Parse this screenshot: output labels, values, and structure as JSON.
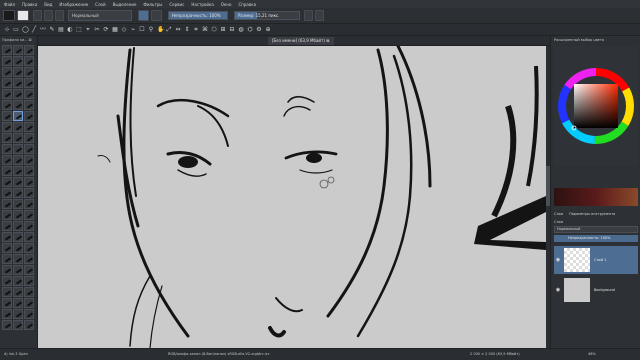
{
  "menu": [
    "Файл",
    "Правка",
    "Вид",
    "Изображение",
    "Слой",
    "Выделение",
    "Фильтры",
    "Сервис",
    "Настройка",
    "Окно",
    "Справка"
  ],
  "topbar": {
    "blend_mode": "Нормальный",
    "opacity_label": "Непрозрачность: 100%",
    "opacity_fraction": 1.0,
    "size_label": "Размер: 15,21 пикс.",
    "size_fraction": 0.35
  },
  "left_panel": {
    "title": "Профили ки... ⊠"
  },
  "canvas": {
    "tab_title": "[Без имени] (63,9 Мбайт) ⊠"
  },
  "right_panel": {
    "color_selector_title": "Расширенный выбор цвета",
    "tab_tools": "Слои",
    "tab_options": "Параметры инструмента",
    "layers_title": "Слои",
    "blend_mode": "Нормальный",
    "opacity_label": "Непрозрачность: 100%",
    "layers": [
      {
        "name": "Слой 1",
        "visible": true,
        "active": true
      },
      {
        "name": "Background",
        "visible": true,
        "active": false
      }
    ]
  },
  "status": {
    "brush": "d) Ink-3 Gpen",
    "color_info": "RGB/альфа-канал (8-бит/канал) sRGB-elle-V2-srgbtrc.icc",
    "dimensions": "2 000 × 2 000 (63,9 Мбайт)",
    "zoom": "48%"
  },
  "colors": {
    "accent": "#4d6d92",
    "canvas": "#cbcbcb",
    "ink": "#141414"
  }
}
